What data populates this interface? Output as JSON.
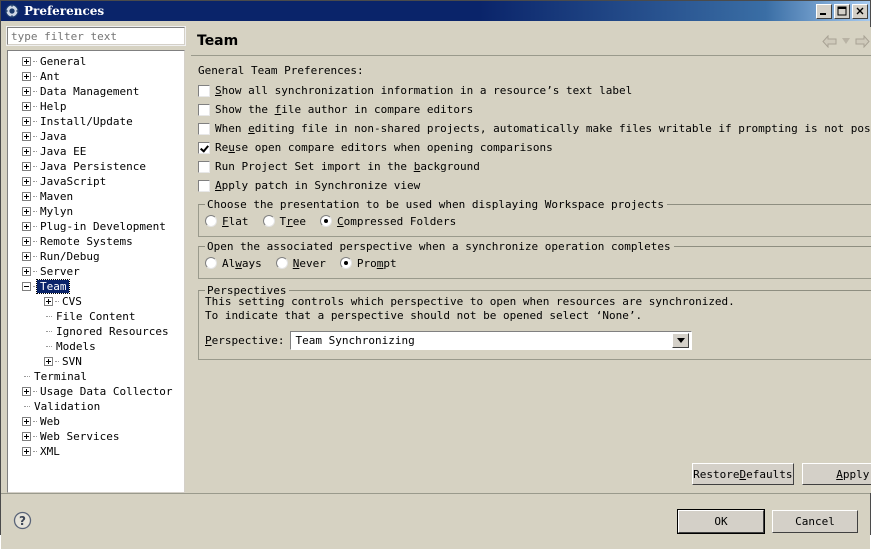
{
  "window": {
    "title": "Preferences",
    "icon": "gear-icon",
    "controls": {
      "minimize": "minimize-icon",
      "maximize": "maximize-icon",
      "close": "close-icon"
    }
  },
  "filter": {
    "placeholder": "type filter text",
    "value": ""
  },
  "tree": {
    "items": [
      {
        "label": "General",
        "depth": 0,
        "expander": "plus",
        "selected": false
      },
      {
        "label": "Ant",
        "depth": 0,
        "expander": "plus",
        "selected": false
      },
      {
        "label": "Data Management",
        "depth": 0,
        "expander": "plus",
        "selected": false
      },
      {
        "label": "Help",
        "depth": 0,
        "expander": "plus",
        "selected": false
      },
      {
        "label": "Install/Update",
        "depth": 0,
        "expander": "plus",
        "selected": false
      },
      {
        "label": "Java",
        "depth": 0,
        "expander": "plus",
        "selected": false
      },
      {
        "label": "Java EE",
        "depth": 0,
        "expander": "plus",
        "selected": false
      },
      {
        "label": "Java Persistence",
        "depth": 0,
        "expander": "plus",
        "selected": false
      },
      {
        "label": "JavaScript",
        "depth": 0,
        "expander": "plus",
        "selected": false
      },
      {
        "label": "Maven",
        "depth": 0,
        "expander": "plus",
        "selected": false
      },
      {
        "label": "Mylyn",
        "depth": 0,
        "expander": "plus",
        "selected": false
      },
      {
        "label": "Plug-in Development",
        "depth": 0,
        "expander": "plus",
        "selected": false
      },
      {
        "label": "Remote Systems",
        "depth": 0,
        "expander": "plus",
        "selected": false
      },
      {
        "label": "Run/Debug",
        "depth": 0,
        "expander": "plus",
        "selected": false
      },
      {
        "label": "Server",
        "depth": 0,
        "expander": "plus",
        "selected": false
      },
      {
        "label": "Team",
        "depth": 0,
        "expander": "minus",
        "selected": true
      },
      {
        "label": "CVS",
        "depth": 1,
        "expander": "plus",
        "selected": false
      },
      {
        "label": "File Content",
        "depth": 1,
        "expander": "none",
        "selected": false
      },
      {
        "label": "Ignored Resources",
        "depth": 1,
        "expander": "none",
        "selected": false
      },
      {
        "label": "Models",
        "depth": 1,
        "expander": "none",
        "selected": false
      },
      {
        "label": "SVN",
        "depth": 1,
        "expander": "plus",
        "selected": false
      },
      {
        "label": "Terminal",
        "depth": 0,
        "expander": "none",
        "selected": false
      },
      {
        "label": "Usage Data Collector",
        "depth": 0,
        "expander": "plus",
        "selected": false
      },
      {
        "label": "Validation",
        "depth": 0,
        "expander": "none",
        "selected": false
      },
      {
        "label": "Web",
        "depth": 0,
        "expander": "plus",
        "selected": false
      },
      {
        "label": "Web Services",
        "depth": 0,
        "expander": "plus",
        "selected": false
      },
      {
        "label": "XML",
        "depth": 0,
        "expander": "plus",
        "selected": false
      }
    ]
  },
  "page": {
    "title": "Team",
    "nav": {
      "back": "arrow-left-icon",
      "back_menu": "chevron-down-icon",
      "forward": "arrow-right-icon",
      "forward_menu": "chevron-down-icon",
      "view_menu": "chevron-down-icon"
    },
    "general_label": "General Team Preferences:",
    "checkboxes": [
      {
        "pre": "",
        "mnemonic": "S",
        "post": "how all synchronization information in a resource’s text label",
        "checked": false
      },
      {
        "pre": "Show the ",
        "mnemonic": "f",
        "post": "ile author in compare editors",
        "checked": false
      },
      {
        "pre": "When ",
        "mnemonic": "e",
        "post": "diting file in non-shared projects, automatically make files writable if prompting is not possible",
        "checked": false
      },
      {
        "pre": "Re",
        "mnemonic": "u",
        "post": "se open compare editors when opening comparisons",
        "checked": true
      },
      {
        "pre": "Run Project Set import in the ",
        "mnemonic": "b",
        "post": "ackground",
        "checked": false
      },
      {
        "pre": "",
        "mnemonic": "A",
        "post": "pply patch in Synchronize view",
        "checked": false
      }
    ],
    "presentation_group": {
      "title": "Choose the presentation to be used when displaying Workspace projects",
      "options": [
        {
          "pre": "",
          "mnemonic": "F",
          "post": "lat",
          "selected": false
        },
        {
          "pre": "T",
          "mnemonic": "r",
          "post": "ee",
          "selected": false
        },
        {
          "pre": "",
          "mnemonic": "C",
          "post": "ompressed Folders",
          "selected": true
        }
      ]
    },
    "perspective_open_group": {
      "title": "Open the associated perspective when a synchronize operation completes",
      "options": [
        {
          "pre": "Al",
          "mnemonic": "w",
          "post": "ays",
          "selected": false
        },
        {
          "pre": "",
          "mnemonic": "N",
          "post": "ever",
          "selected": false
        },
        {
          "pre": "Pro",
          "mnemonic": "m",
          "post": "pt",
          "selected": true
        }
      ]
    },
    "perspectives_group": {
      "title": "Perspectives",
      "description_line1": "This setting controls which perspective to open when resources are synchronized.",
      "description_line2": "To indicate that a perspective should not be opened select ‘None’.",
      "field_label_pre": "",
      "field_label_mnemonic": "P",
      "field_label_post": "erspective:",
      "combo_value": "Team Synchronizing",
      "combo_arrow": "chevron-down-icon"
    },
    "restore_defaults_pre": "Restore ",
    "restore_defaults_mnemonic": "D",
    "restore_defaults_post": "efaults",
    "apply_pre": "",
    "apply_mnemonic": "A",
    "apply_post": "pply"
  },
  "footer": {
    "help_icon": "help-question-icon",
    "ok_label": "OK",
    "cancel_label": "Cancel"
  },
  "colors": {
    "title_bar_start": "#0a246a",
    "title_bar_end": "#a6caf0",
    "dialog_bg": "#d6d2c2",
    "button_face": "#d4d0c8",
    "selection_bg": "#0a246a",
    "field_bg": "#ffffff",
    "border": "#9a9a8c"
  }
}
